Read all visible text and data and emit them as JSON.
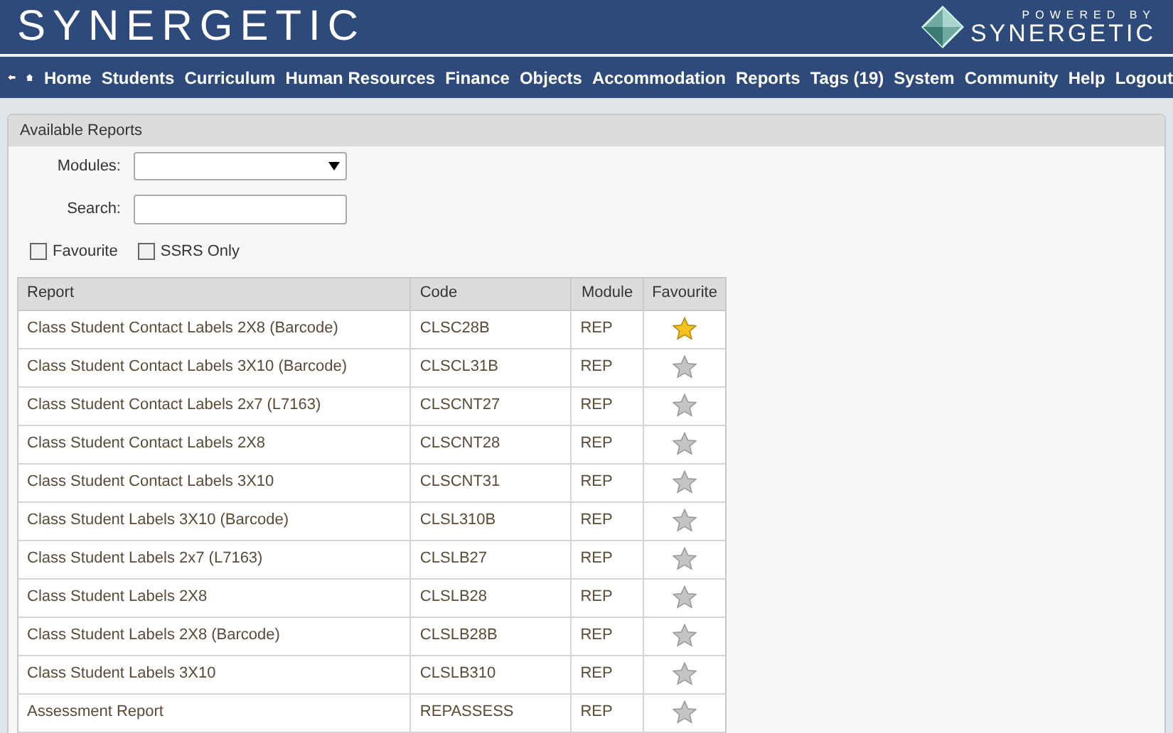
{
  "header": {
    "logo": "SYNERGETIC",
    "powered_by": "POWERED BY",
    "powered_brand": "SYNERGETIC"
  },
  "nav": {
    "items": [
      "Home",
      "Students",
      "Curriculum",
      "Human Resources",
      "Finance",
      "Objects",
      "Accommodation",
      "Reports",
      "Tags (19)",
      "System",
      "Community",
      "Help",
      "Logout"
    ]
  },
  "panel": {
    "title": "Available Reports",
    "modules": {
      "label": "Modules:"
    },
    "search": {
      "label": "Search:"
    },
    "filters": [
      {
        "label": "Favourite",
        "checked": false
      },
      {
        "label": "SSRS Only",
        "checked": false
      }
    ],
    "table": {
      "columns": [
        "Report",
        "Code",
        "Module",
        "Favourite"
      ],
      "rows": [
        {
          "report": "Class Student Contact Labels 2X8 (Barcode)",
          "code": "CLSC28B",
          "module": "REP",
          "favourite": true
        },
        {
          "report": "Class Student Contact Labels 3X10 (Barcode)",
          "code": "CLSCL31B",
          "module": "REP",
          "favourite": false
        },
        {
          "report": "Class Student Contact Labels 2x7 (L7163)",
          "code": "CLSCNT27",
          "module": "REP",
          "favourite": false
        },
        {
          "report": "Class Student Contact Labels 2X8",
          "code": "CLSCNT28",
          "module": "REP",
          "favourite": false
        },
        {
          "report": "Class Student Contact Labels 3X10",
          "code": "CLSCNT31",
          "module": "REP",
          "favourite": false
        },
        {
          "report": "Class Student Labels 3X10 (Barcode)",
          "code": "CLSL310B",
          "module": "REP",
          "favourite": false
        },
        {
          "report": "Class Student Labels 2x7 (L7163)",
          "code": "CLSLB27",
          "module": "REP",
          "favourite": false
        },
        {
          "report": "Class Student Labels 2X8",
          "code": "CLSLB28",
          "module": "REP",
          "favourite": false
        },
        {
          "report": "Class Student Labels 2X8 (Barcode)",
          "code": "CLSLB28B",
          "module": "REP",
          "favourite": false
        },
        {
          "report": "Class Student Labels 3X10",
          "code": "CLSLB310",
          "module": "REP",
          "favourite": false
        },
        {
          "report": "Assessment Report",
          "code": "REPASSESS",
          "module": "REP",
          "favourite": false
        }
      ]
    }
  }
}
